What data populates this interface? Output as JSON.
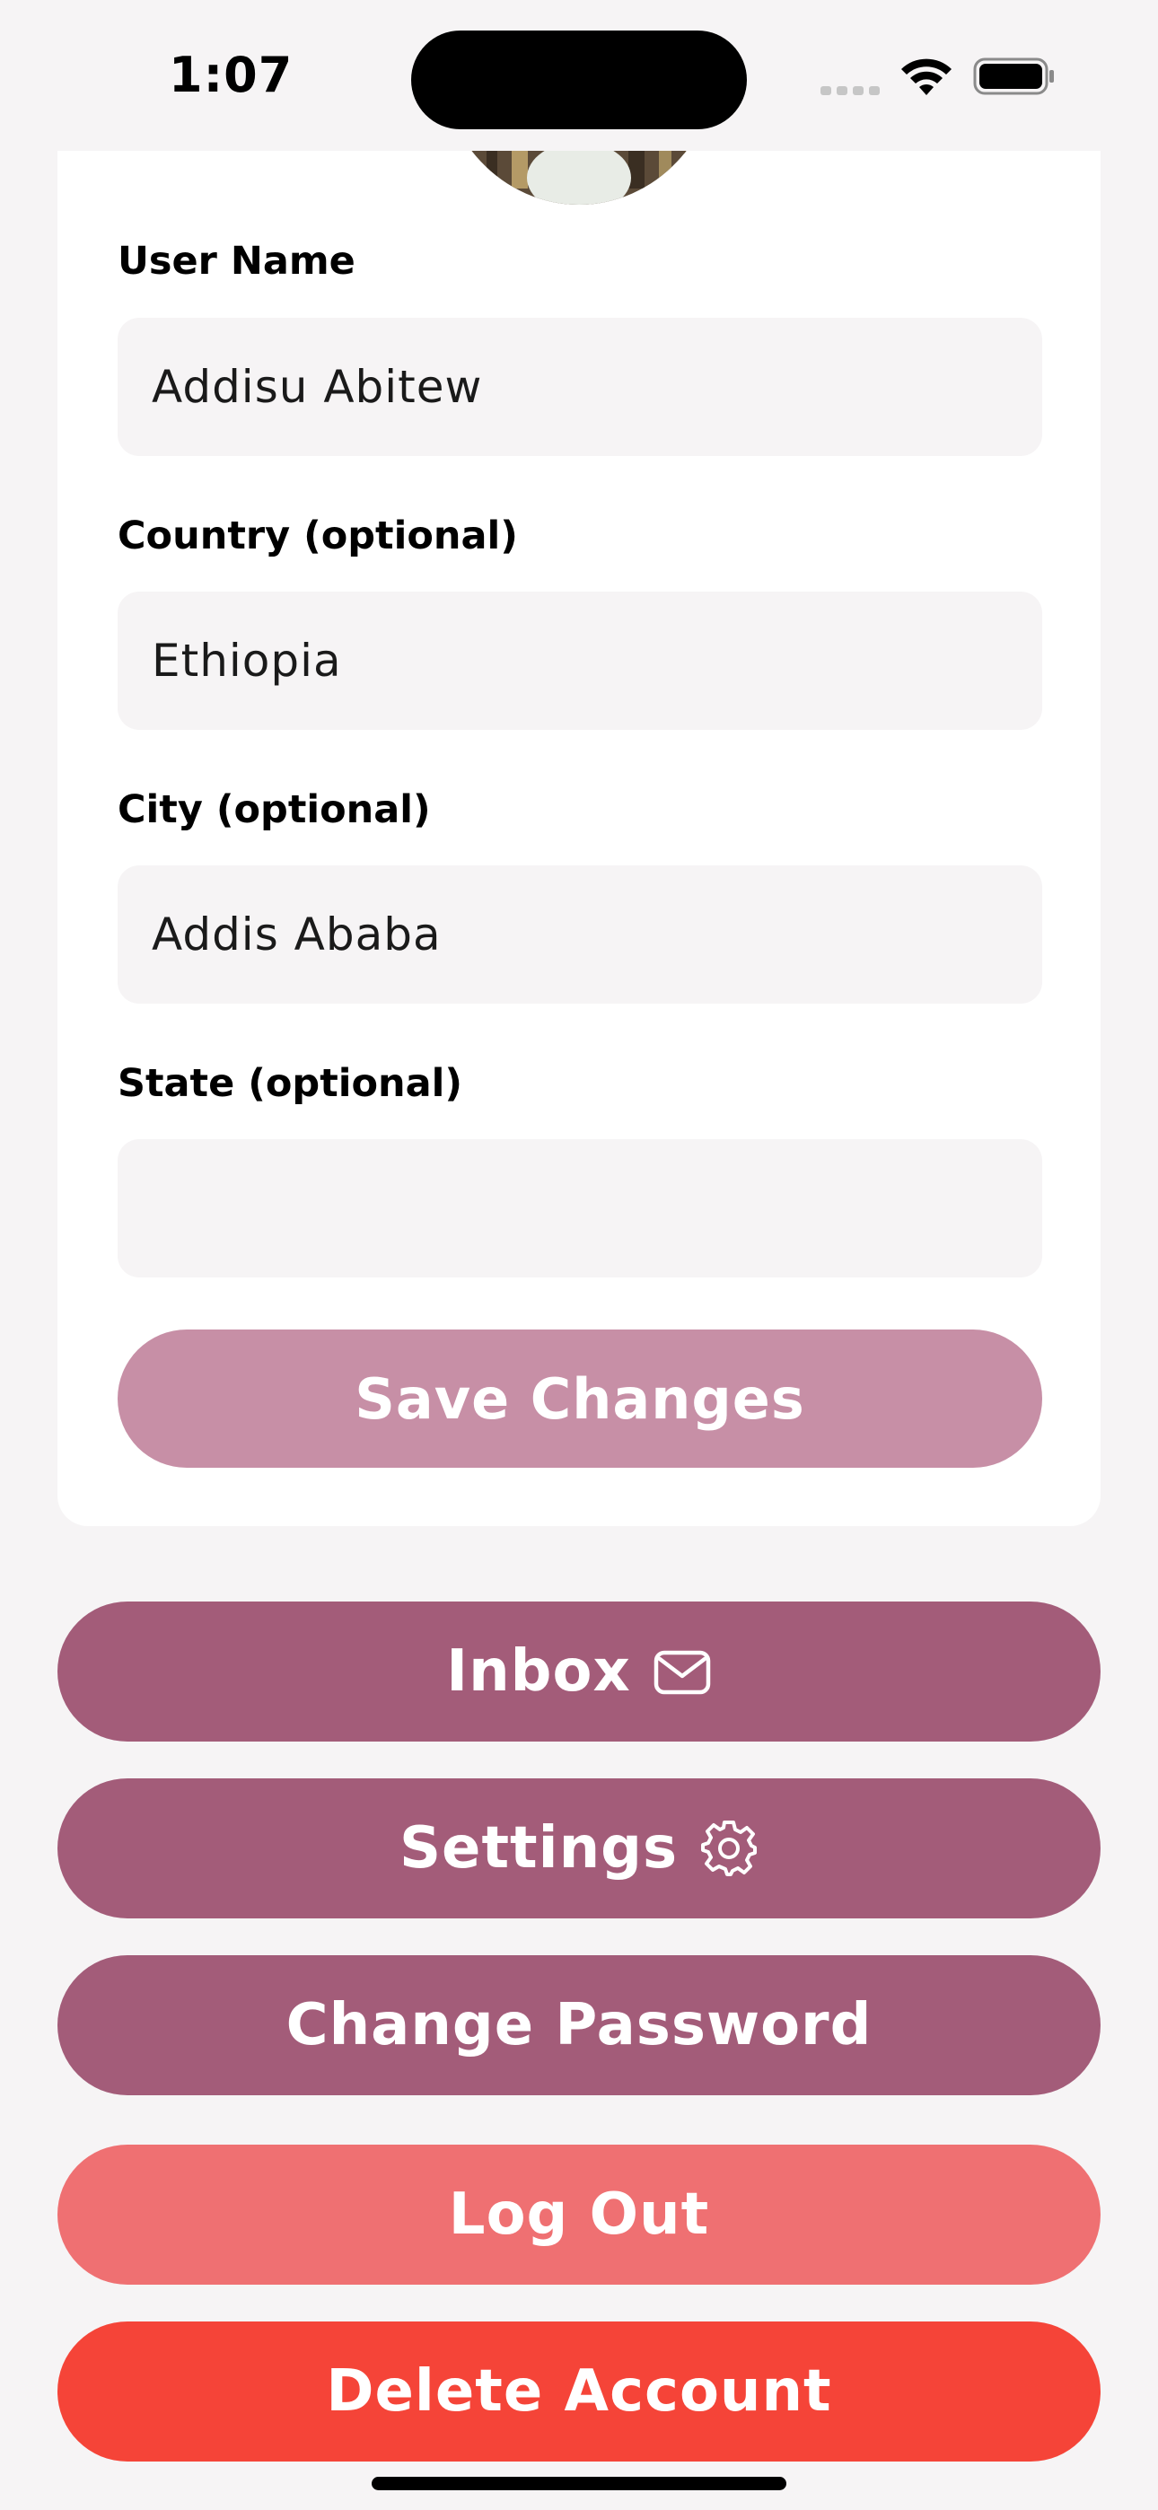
{
  "status_bar": {
    "time": "1:07"
  },
  "profile_form": {
    "fields": [
      {
        "label": "User Name",
        "value": "Addisu Abitew"
      },
      {
        "label": "Country (optional)",
        "value": "Ethiopia"
      },
      {
        "label": "City (optional)",
        "value": "Addis Ababa"
      },
      {
        "label": "State (optional)",
        "value": ""
      }
    ],
    "save_label": "Save Changes"
  },
  "actions": {
    "inbox_label": "Inbox",
    "inbox_icon": "envelope-icon",
    "settings_label": "Settings",
    "settings_icon": "gear-icon",
    "change_password_label": "Change Password",
    "log_out_label": "Log Out",
    "delete_account_label": "Delete Account"
  },
  "colors": {
    "background": "#f6f4f5",
    "save_button": "#c78fa6",
    "primary_button": "#a35c79",
    "log_out_button": "#ef7072",
    "delete_button": "#f54438"
  }
}
